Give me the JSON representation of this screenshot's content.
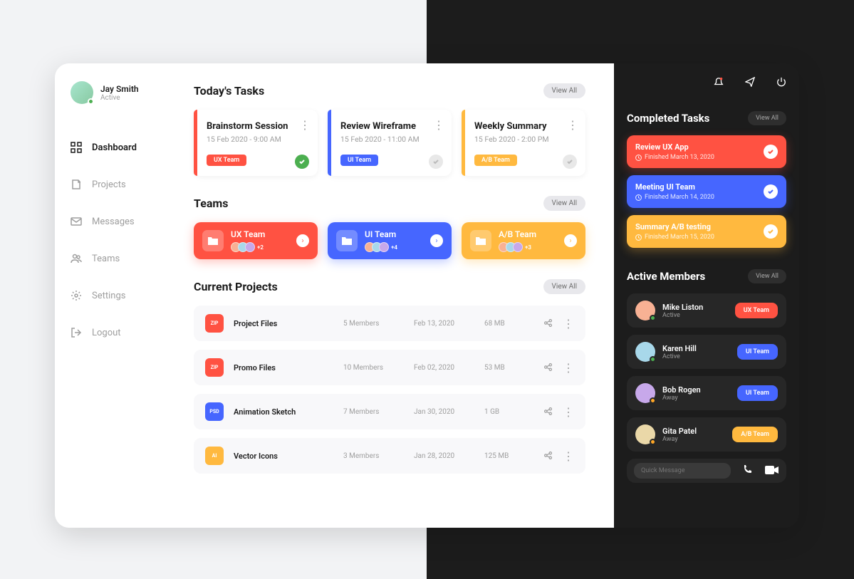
{
  "user": {
    "name": "Jay Smith",
    "status": "Active"
  },
  "nav": {
    "dashboard": "Dashboard",
    "projects": "Projects",
    "messages": "Messages",
    "teams": "Teams",
    "settings": "Settings",
    "logout": "Logout"
  },
  "sections": {
    "today": "Today's Tasks",
    "teams": "Teams",
    "projects": "Current Projects",
    "completed": "Completed Tasks",
    "active_members": "Active Members"
  },
  "view_all": "View All",
  "tasks": [
    {
      "title": "Brainstorm Session",
      "time": "15 Feb 2020 - 9:00 AM",
      "tag": "UX Team",
      "color": "#ff5242",
      "done": true
    },
    {
      "title": "Review Wireframe",
      "time": "15 Feb 2020 - 11:00 AM",
      "tag": "UI Team",
      "color": "#4666ff",
      "done": false
    },
    {
      "title": "Weekly Summary",
      "time": "15 Feb 2020 - 2:00 PM",
      "tag": "A/B Team",
      "color": "#ffb93f",
      "done": false
    }
  ],
  "teams": [
    {
      "name": "UX Team",
      "more": "+2",
      "color": "#ff5242"
    },
    {
      "name": "UI Team",
      "more": "+4",
      "color": "#4666ff"
    },
    {
      "name": "A/B Team",
      "more": "+3",
      "color": "#ffb93f"
    }
  ],
  "projects": [
    {
      "ext": "ZIP",
      "name": "Project Files",
      "members": "5 Members",
      "date": "Feb 13, 2020",
      "size": "68 MB",
      "color": "#ff5242"
    },
    {
      "ext": "ZIP",
      "name": "Promo Files",
      "members": "10 Members",
      "date": "Feb 02, 2020",
      "size": "53 MB",
      "color": "#ff5242"
    },
    {
      "ext": "PSD",
      "name": "Animation Sketch",
      "members": "7 Members",
      "date": "Jan 30, 2020",
      "size": "1 GB",
      "color": "#4666ff"
    },
    {
      "ext": "AI",
      "name": "Vector Icons",
      "members": "3 Members",
      "date": "Jan 28, 2020",
      "size": "125 MB",
      "color": "#ffb93f"
    }
  ],
  "completed": [
    {
      "title": "Review UX App",
      "date": "Finished March 13, 2020",
      "color": "#ff5242"
    },
    {
      "title": "Meeting UI Team",
      "date": "Finished March 14, 2020",
      "color": "#4666ff"
    },
    {
      "title": "Summary A/B testing",
      "date": "Finished March 15, 2020",
      "color": "#ffb93f"
    }
  ],
  "members": [
    {
      "name": "Mike Liston",
      "status": "Active",
      "tag": "UX Team",
      "tag_color": "#ff5242",
      "dot": "active"
    },
    {
      "name": "Karen Hill",
      "status": "Active",
      "tag": "UI Team",
      "tag_color": "#4666ff",
      "dot": "active"
    },
    {
      "name": "Bob Rogen",
      "status": "Away",
      "tag": "UI Team",
      "tag_color": "#4666ff",
      "dot": "away"
    },
    {
      "name": "Gita Patel",
      "status": "Away",
      "tag": "A/B Team",
      "tag_color": "#ffb93f",
      "dot": "away"
    }
  ],
  "quick_msg": {
    "placeholder": "Quick Message"
  }
}
